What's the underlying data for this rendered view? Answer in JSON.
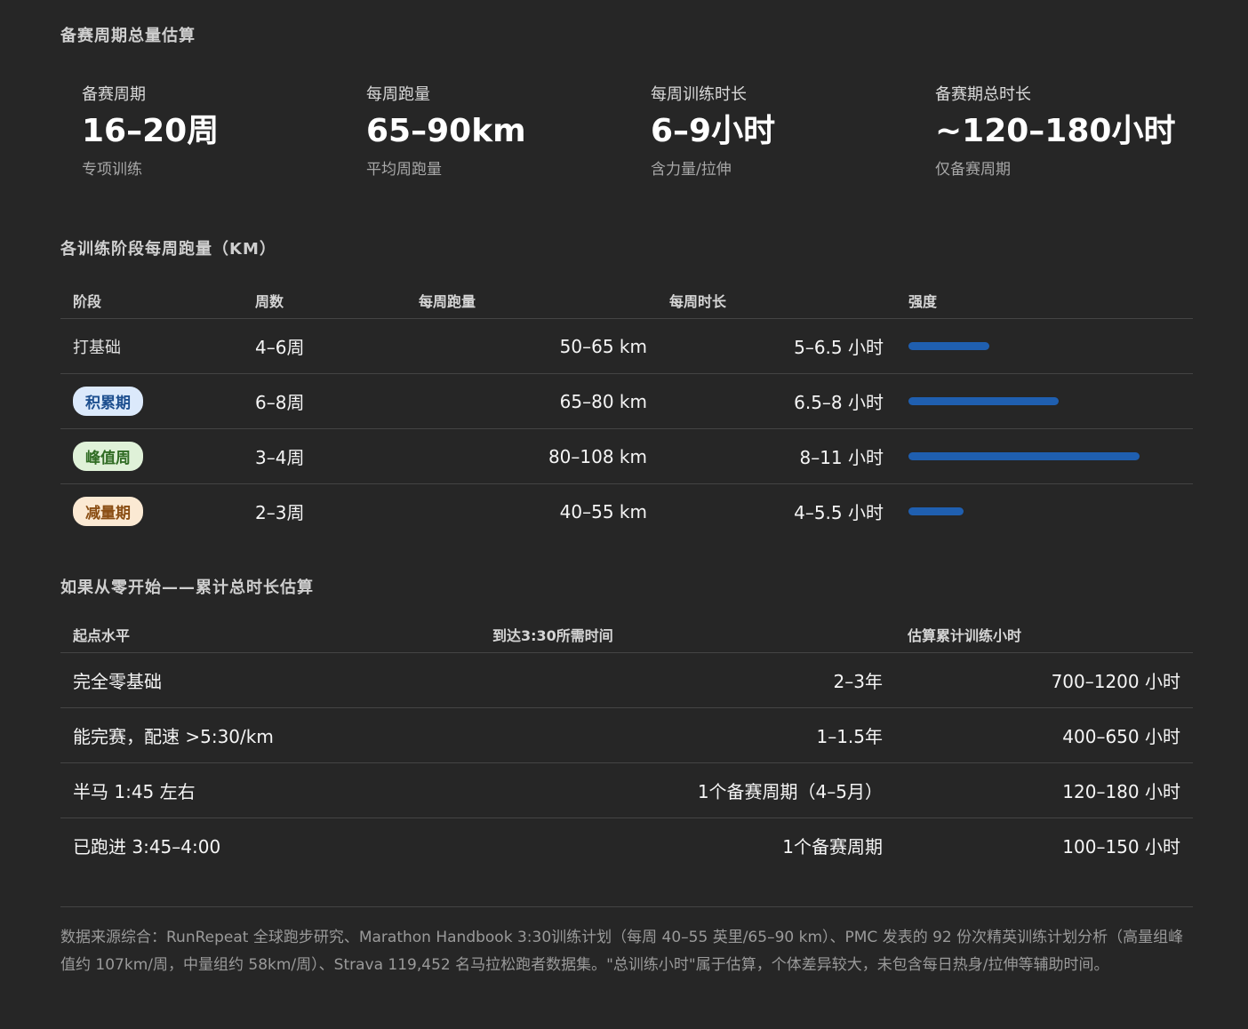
{
  "summary": {
    "title": "备赛周期总量估算",
    "stats": [
      {
        "label": "备赛周期",
        "value": "16–20周",
        "sub": "专项训练"
      },
      {
        "label": "每周跑量",
        "value": "65–90km",
        "sub": "平均周跑量"
      },
      {
        "label": "每周训练时长",
        "value": "6–9小时",
        "sub": "含力量/拉伸"
      },
      {
        "label": "备赛期总时长",
        "value": "~120–180小时",
        "sub": "仅备赛周期"
      }
    ]
  },
  "phases": {
    "title": "各训练阶段每周跑量（KM）",
    "headers": [
      "阶段",
      "周数",
      "每周跑量",
      "每周时长",
      "强度"
    ],
    "rows": [
      {
        "phase": "打基础",
        "weeks": "4–6周",
        "km": "50–65 km",
        "hours": "5–6.5 小时",
        "intensity": 0.35
      },
      {
        "phase": "积累期",
        "weeks": "6–8周",
        "km": "65–80 km",
        "hours": "6.5–8 小时",
        "intensity": 0.65
      },
      {
        "phase": "峰值周",
        "weeks": "3–4周",
        "km": "80–108 km",
        "hours": "8–11 小时",
        "intensity": 1.0
      },
      {
        "phase": "减量期",
        "weeks": "2–3周",
        "km": "40–55 km",
        "hours": "4–5.5 小时",
        "intensity": 0.24
      }
    ],
    "pill_colors": {
      "accumulate": "#dbe9fb",
      "peak": "#dff1d8",
      "taper": "#fbe9d3"
    },
    "bar_color": "#1f5fb0"
  },
  "from_zero": {
    "title": "如果从零开始——累计总时长估算",
    "headers": [
      "起点水平",
      "到达3:30所需时间",
      "估算累计训练小时"
    ],
    "rows": [
      {
        "level": "完全零基础",
        "time": "2–3年",
        "hours": "700–1200 小时"
      },
      {
        "level": "能完赛，配速 >5:30/km",
        "time": "1–1.5年",
        "hours": "400–650 小时"
      },
      {
        "level": "半马 1:45 左右",
        "time": "1个备赛周期（4–5月）",
        "hours": "120–180 小时"
      },
      {
        "level": "已跑进 3:45–4:00",
        "time": "1个备赛周期",
        "hours": "100–150 小时"
      }
    ]
  },
  "footnote": "数据来源综合：RunRepeat 全球跑步研究、Marathon Handbook 3:30训练计划（每周 40–55 英里/65–90 km）、PMC 发表的 92 份次精英训练计划分析（高量组峰值约 107km/周，中量组约 58km/周）、Strava 119,452 名马拉松跑者数据集。\"总训练小时\"属于估算，个体差异较大，未包含每日热身/拉伸等辅助时间。"
}
